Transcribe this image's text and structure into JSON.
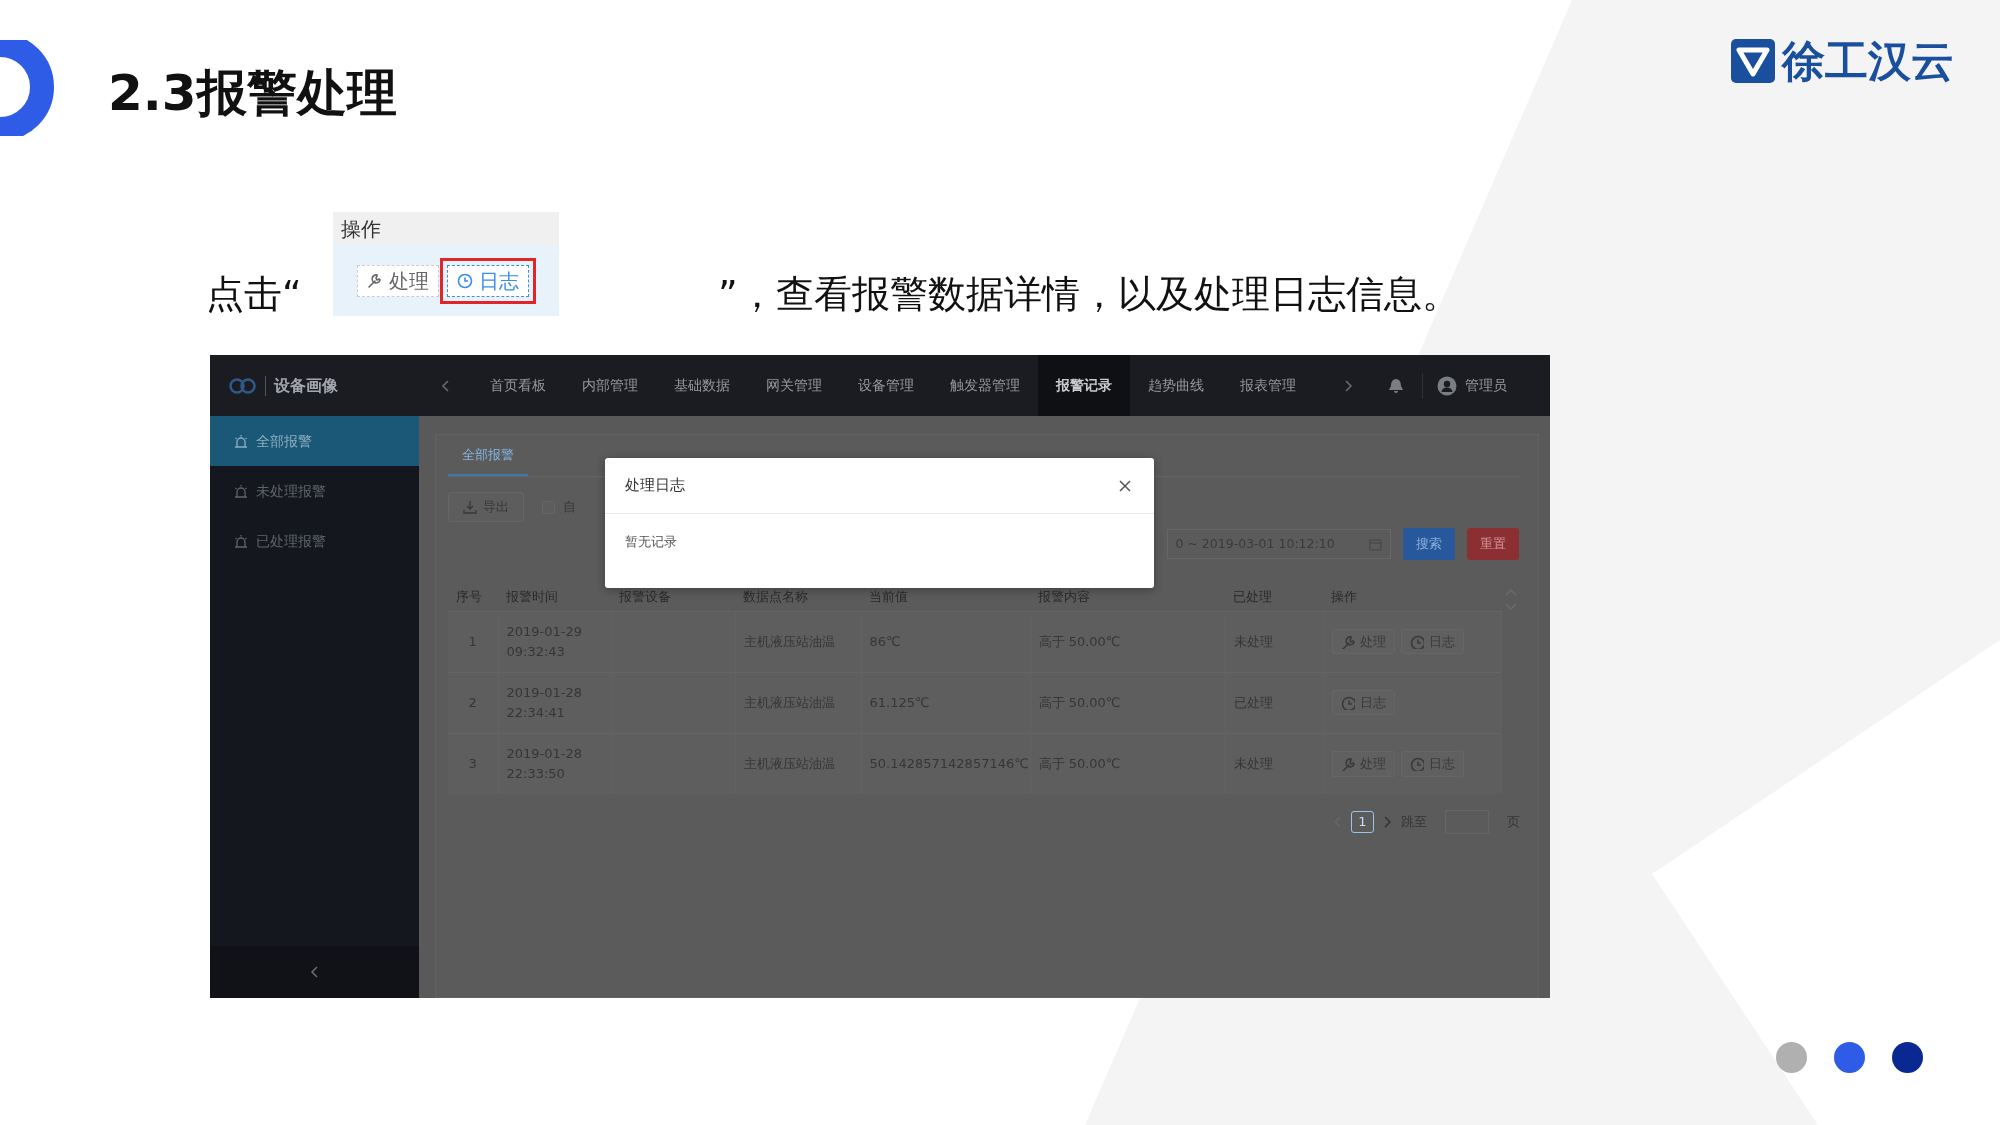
{
  "slide": {
    "title": "2.3报警处理",
    "logo": "徐工汉云",
    "instruction": {
      "before": "点击“",
      "after": "”，查看报警数据详情，以及处理日志信息。"
    },
    "inset": {
      "header": "操作",
      "buttons": [
        {
          "kind": "handle",
          "label": "处理",
          "highlighted": false
        },
        {
          "kind": "log",
          "label": "日志",
          "highlighted": true
        }
      ]
    },
    "dots": [
      {
        "color": "#b0b0b0"
      },
      {
        "color": "#2f5ce6"
      },
      {
        "color": "#0a2891"
      }
    ]
  },
  "app": {
    "brand": "设备画像",
    "nav": [
      {
        "label": "首页看板",
        "selected": false
      },
      {
        "label": "内部管理",
        "selected": false
      },
      {
        "label": "基础数据",
        "selected": false
      },
      {
        "label": "网关管理",
        "selected": false
      },
      {
        "label": "设备管理",
        "selected": false
      },
      {
        "label": "触发器管理",
        "selected": false
      },
      {
        "label": "报警记录",
        "selected": true
      },
      {
        "label": "趋势曲线",
        "selected": false
      },
      {
        "label": "报表管理",
        "selected": false
      }
    ],
    "user": "管理员",
    "sidebar": [
      {
        "label": "全部报警",
        "selected": true
      },
      {
        "label": "未处理报警",
        "selected": false
      },
      {
        "label": "已处理报警",
        "selected": false
      }
    ],
    "tabs": [
      {
        "label": "全部报警",
        "selected": true
      }
    ],
    "export": "导出",
    "auto_checkbox": {
      "label": "自",
      "checked": false
    },
    "date_range": "0 ~ 2019-03-01 10:12:10",
    "search": "搜索",
    "reset": "重置",
    "table": {
      "columns": [
        "序号",
        "报警时间",
        "报警设备",
        "数据点名称",
        "当前值",
        "报警内容",
        "已处理",
        "操作"
      ],
      "rows": [
        {
          "index": "1",
          "time": "2019-01-29 09:32:43",
          "point": "主机液压站油温",
          "value": "86℃",
          "content": "高于 50.00℃",
          "status": "未处理",
          "actions": [
            {
              "kind": "handle",
              "label": "处理"
            },
            {
              "kind": "log",
              "label": "日志"
            }
          ]
        },
        {
          "index": "2",
          "time": "2019-01-28 22:34:41",
          "point": "主机液压站油温",
          "value": "61.125℃",
          "content": "高于 50.00℃",
          "status": "已处理",
          "actions": [
            {
              "kind": "log",
              "label": "日志"
            }
          ]
        },
        {
          "index": "3",
          "time": "2019-01-28 22:33:50",
          "point": "主机液压站油温",
          "value": "50.142857142857146℃",
          "content": "高于 50.00℃",
          "status": "未处理",
          "actions": [
            {
              "kind": "handle",
              "label": "处理"
            },
            {
              "kind": "log",
              "label": "日志"
            }
          ]
        }
      ]
    },
    "pagination": {
      "page": "1",
      "jump": "跳至",
      "unit": "页"
    },
    "modal": {
      "title": "处理日志",
      "body": "暂无记录"
    }
  }
}
